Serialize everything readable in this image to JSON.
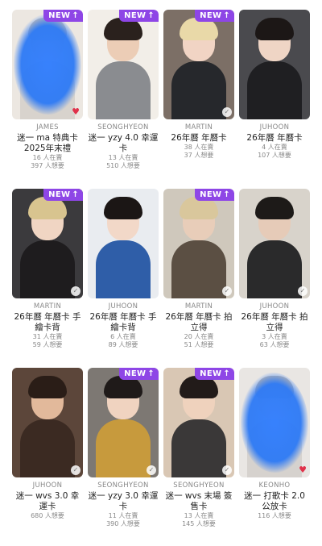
{
  "badge_label": "NEW",
  "badge_arrow": "↑",
  "colors": {
    "badge": "#8e46e6",
    "heart": "#e0314a"
  },
  "cards": [
    {
      "member": "JAMES",
      "title": "迷一 ma 特典卡 2025年末禮",
      "stats": [
        "16 人在賣",
        "397 人想要"
      ],
      "new": true,
      "mark": "heart",
      "redacted": true,
      "bg": "#ece7e1",
      "skin": "#f0d9c8",
      "hair": "#c9c0b4",
      "cloth": "#d8d3cd"
    },
    {
      "member": "SEONGHYEON",
      "title": "迷一 yzy 4.0 幸運卡",
      "stats": [
        "13 人在賣",
        "510 人想要"
      ],
      "new": true,
      "mark": "none",
      "redacted": false,
      "bg": "#f2eee8",
      "skin": "#eccdb6",
      "hair": "#2a211d",
      "cloth": "#8a8c90"
    },
    {
      "member": "MARTIN",
      "title": "26年曆 年曆卡",
      "stats": [
        "38 人在賣",
        "37 人想要"
      ],
      "new": true,
      "mark": "check",
      "redacted": false,
      "bg": "#7c6f66",
      "skin": "#f1d4c4",
      "hair": "#e9d9a8",
      "cloth": "#26282c"
    },
    {
      "member": "JUHOON",
      "title": "26年曆 年曆卡",
      "stats": [
        "4 人在賣",
        "107 人想要"
      ],
      "new": false,
      "mark": "none",
      "redacted": false,
      "bg": "#4a4a4e",
      "skin": "#efd5c5",
      "hair": "#1c1716",
      "cloth": "#1f1f22"
    },
    {
      "member": "MARTIN",
      "title": "26年曆 年曆卡 手繪卡背",
      "stats": [
        "31 人在賣",
        "59 人想要"
      ],
      "new": true,
      "mark": "check",
      "redacted": false,
      "bg": "#3b3a3d",
      "skin": "#f0d5c3",
      "hair": "#d8c48f",
      "cloth": "#1e1c1e"
    },
    {
      "member": "JUHOON",
      "title": "26年曆 年曆卡 手繪卡背",
      "stats": [
        "6 人在賣",
        "89 人想要"
      ],
      "new": false,
      "mark": "none",
      "redacted": false,
      "bg": "#e9ecf0",
      "skin": "#f2d8c8",
      "hair": "#1b1615",
      "cloth": "#2f5ea8"
    },
    {
      "member": "MARTIN",
      "title": "26年曆 年曆卡 拍立得",
      "stats": [
        "20 人在賣",
        "51 人想要"
      ],
      "new": true,
      "mark": "check",
      "redacted": false,
      "bg": "#cfc8bc",
      "skin": "#e8cdb9",
      "hair": "#d9c79c",
      "cloth": "#5b4f43"
    },
    {
      "member": "JUHOON",
      "title": "26年曆 年曆卡 拍立得",
      "stats": [
        "3 人在賣",
        "63 人想要"
      ],
      "new": false,
      "mark": "check",
      "redacted": false,
      "bg": "#d8d3cb",
      "skin": "#e6cbb8",
      "hair": "#1d1a18",
      "cloth": "#2a2a2b"
    },
    {
      "member": "JUHOON",
      "title": "迷一 wvs 3.0 幸運卡",
      "stats": [
        "680 人想要"
      ],
      "new": false,
      "mark": "check",
      "redacted": false,
      "bg": "#5c463a",
      "skin": "#e2b99b",
      "hair": "#2a1d17",
      "cloth": "#3b2a22"
    },
    {
      "member": "SEONGHYEON",
      "title": "迷一 yzy 3.0 幸運卡",
      "stats": [
        "11 人在賣",
        "390 人想要"
      ],
      "new": true,
      "mark": "check",
      "redacted": false,
      "bg": "#7d7873",
      "skin": "#f0d3c0",
      "hair": "#1f1a19",
      "cloth": "#c79a3d"
    },
    {
      "member": "SEONGHYEON",
      "title": "迷一 wvs 末場 簽售卡",
      "stats": [
        "13 人在賣",
        "145 人想要"
      ],
      "new": true,
      "mark": "check",
      "redacted": false,
      "bg": "#d9c7b4",
      "skin": "#efd2bd",
      "hair": "#221b19",
      "cloth": "#3a3838"
    },
    {
      "member": "KEONHO",
      "title": "迷一 打歌卡 2.0 公放卡",
      "stats": [
        "116 人想要"
      ],
      "new": false,
      "mark": "heart",
      "redacted": true,
      "bg": "#e9e6e3",
      "skin": "#f0d9c8",
      "hair": "#bfb8b0",
      "cloth": "#d6d2ce"
    }
  ]
}
